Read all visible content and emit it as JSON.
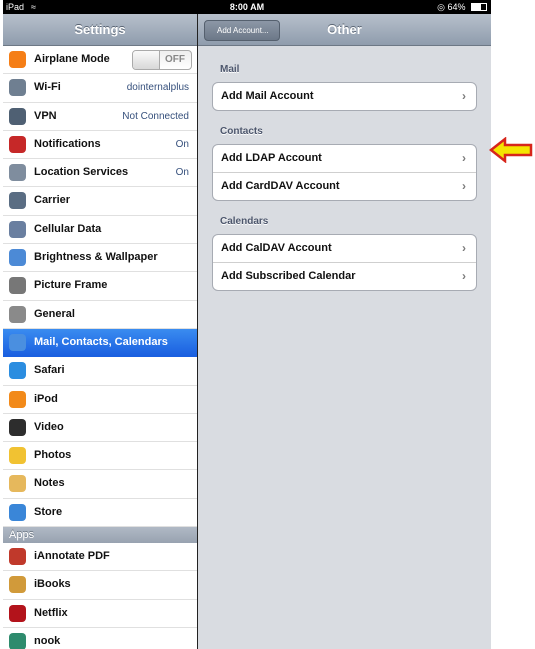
{
  "status_bar": {
    "carrier": "iPad",
    "time": "8:00 AM",
    "battery": "64%",
    "wifi_icon": "wifi-icon",
    "lock_icon": "rotation-lock-icon"
  },
  "sidebar": {
    "title": "Settings",
    "items": [
      {
        "label": "Airplane Mode",
        "toggle": "OFF",
        "icon": "airplane-icon",
        "color": "#f57e16"
      },
      {
        "label": "Wi-Fi",
        "value": "dointernalplus",
        "icon": "wifi-icon",
        "color": "#6f7f91"
      },
      {
        "label": "VPN",
        "value": "Not Connected",
        "icon": "vpn-icon",
        "color": "#4f6073"
      },
      {
        "label": "Notifications",
        "value": "On",
        "icon": "notifications-icon",
        "color": "#c62828"
      },
      {
        "label": "Location Services",
        "value": "On",
        "icon": "location-icon",
        "color": "#7f8d9e"
      },
      {
        "label": "Carrier",
        "icon": "carrier-icon",
        "color": "#5a6d83"
      },
      {
        "label": "Cellular Data",
        "icon": "cellular-icon",
        "color": "#6a7fa0"
      },
      {
        "label": "Brightness & Wallpaper",
        "icon": "brightness-icon",
        "color": "#4c8ad6"
      },
      {
        "label": "Picture Frame",
        "icon": "picture-frame-icon",
        "color": "#777777"
      },
      {
        "label": "General",
        "icon": "gear-icon",
        "color": "#8a8a8a"
      },
      {
        "label": "Mail, Contacts, Calendars",
        "icon": "mail-icon",
        "color": "#4a8fe0",
        "selected": true
      },
      {
        "label": "Safari",
        "icon": "safari-icon",
        "color": "#2b8de0"
      },
      {
        "label": "iPod",
        "icon": "ipod-icon",
        "color": "#f28a1a"
      },
      {
        "label": "Video",
        "icon": "video-icon",
        "color": "#2d2d2d"
      },
      {
        "label": "Photos",
        "icon": "photos-icon",
        "color": "#f1c232"
      },
      {
        "label": "Notes",
        "icon": "notes-icon",
        "color": "#e6b85c"
      },
      {
        "label": "Store",
        "icon": "store-icon",
        "color": "#3a86d8"
      }
    ],
    "apps_header": "Apps",
    "apps": [
      {
        "label": "iAnnotate PDF",
        "icon": "iannotate-icon",
        "color": "#c0392b"
      },
      {
        "label": "iBooks",
        "icon": "ibooks-icon",
        "color": "#d19a3a"
      },
      {
        "label": "Netflix",
        "icon": "netflix-icon",
        "color": "#b3131b"
      },
      {
        "label": "nook",
        "icon": "nook-icon",
        "color": "#2e8b6d"
      }
    ]
  },
  "detail": {
    "back_label": "Add Account...",
    "title": "Other",
    "groups": [
      {
        "header": "Mail",
        "cells": [
          "Add Mail Account"
        ]
      },
      {
        "header": "Contacts",
        "cells": [
          "Add LDAP Account",
          "Add CardDAV Account"
        ]
      },
      {
        "header": "Calendars",
        "cells": [
          "Add CalDAV Account",
          "Add Subscribed Calendar"
        ]
      }
    ],
    "chevron": "›"
  },
  "annotation": {
    "icon": "arrow-left-icon",
    "color": "#f4e500",
    "stroke": "#d7261b"
  }
}
